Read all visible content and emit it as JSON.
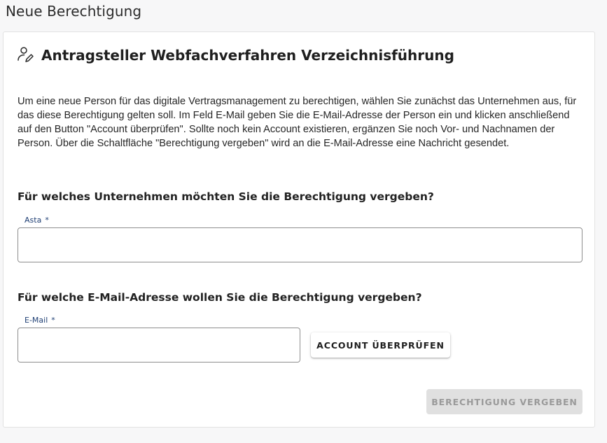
{
  "page": {
    "title": "Neue Berechtigung"
  },
  "card": {
    "icon": "user-edit-icon",
    "title": "Antragsteller Webfachverfahren Verzeichnisführung",
    "intro": "Um eine neue Person für das digitale Vertragsmanagement zu berechtigen, wählen Sie zunächst das Unternehmen aus, für das diese Berechtigung gelten soll. Im Feld E-Mail geben Sie die E-Mail-Adresse der Person ein und klicken anschließend auf den Button \"Account überprüfen\". Sollte noch kein Account existieren, ergänzen Sie noch Vor- und Nachnamen der Person. Über die Schaltfläche \"Berechtigung vergeben\" wird an die E-Mail-Adresse eine Nachricht gesendet."
  },
  "company_section": {
    "heading": "Für welches Unternehmen möchten Sie die Berechtigung vergeben?",
    "field_label": "Asta",
    "required_marker": "*",
    "value": ""
  },
  "email_section": {
    "heading": "Für welche E-Mail-Adresse wollen Sie die Berechtigung vergeben?",
    "field_label": "E-Mail",
    "required_marker": "*",
    "value": "",
    "check_button": "ACCOUNT ÜBERPRÜFEN"
  },
  "actions": {
    "submit_button": "BERECHTIGUNG VERGEBEN",
    "submit_enabled": false
  },
  "colors": {
    "label_blue": "#1f3f74",
    "disabled_button_bg": "#e0e0e0",
    "disabled_button_text": "#9a9a9a"
  }
}
